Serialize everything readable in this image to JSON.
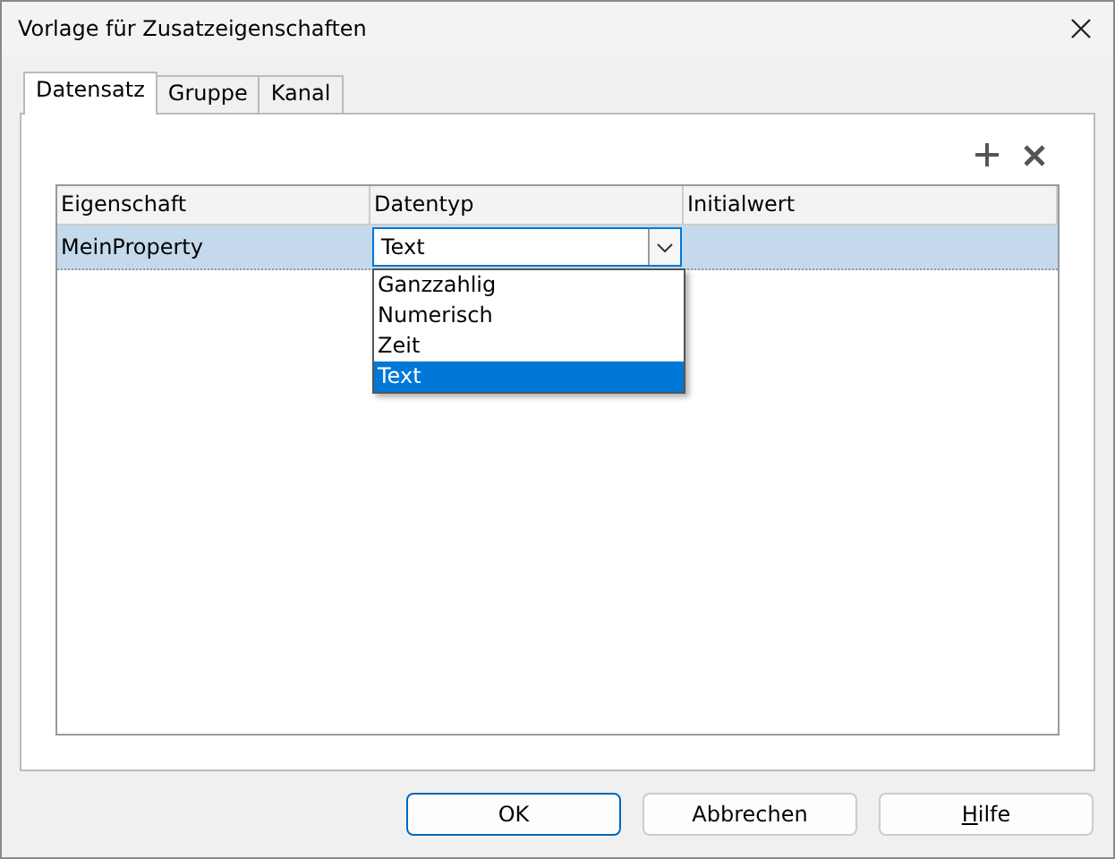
{
  "window": {
    "title": "Vorlage für Zusatzeigenschaften"
  },
  "tabs": [
    {
      "label": "Datensatz",
      "selected": true
    },
    {
      "label": "Gruppe",
      "selected": false
    },
    {
      "label": "Kanal",
      "selected": false
    }
  ],
  "table": {
    "columns": [
      "Eigenschaft",
      "Datentyp",
      "Initialwert"
    ],
    "rows": [
      {
        "property": "MeinProperty",
        "type": "Text",
        "initial_value": "",
        "selected": true
      }
    ]
  },
  "dropdown": {
    "options": [
      {
        "label": "Ganzzahlig",
        "selected": false
      },
      {
        "label": "Numerisch",
        "selected": false
      },
      {
        "label": "Zeit",
        "selected": false
      },
      {
        "label": "Text",
        "selected": true
      }
    ]
  },
  "buttons": [
    {
      "label": "OK",
      "default": true,
      "mnemonic": false
    },
    {
      "label": "Abbrechen",
      "default": false,
      "mnemonic": false
    },
    {
      "label": "Hilfe",
      "default": false,
      "mnemonic": true
    }
  ]
}
